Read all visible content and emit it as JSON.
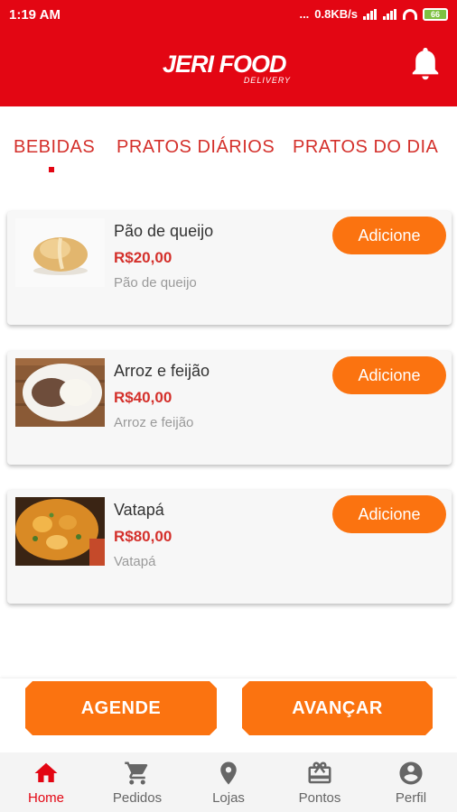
{
  "status_bar": {
    "time": "1:19 AM",
    "dots": "...",
    "network_speed": "0.8KB/s",
    "battery": "66"
  },
  "header": {
    "logo_main": "JERI FOOD",
    "logo_sub": "DELIVERY",
    "bell_icon": "bell-icon"
  },
  "tabs": [
    {
      "label": "BEBIDAS",
      "active": true
    },
    {
      "label": "PRATOS DIÁRIOS",
      "active": false
    },
    {
      "label": "PRATOS DO DIA",
      "active": false
    }
  ],
  "products": [
    {
      "name": "Pão de queijo",
      "price": "R$20,00",
      "description": "Pão de queijo",
      "button": "Adicione"
    },
    {
      "name": "Arroz e feijão",
      "price": "R$40,00",
      "description": "Arroz e feijão",
      "button": "Adicione"
    },
    {
      "name": "Vatapá",
      "price": "R$80,00",
      "description": "Vatapá",
      "button": "Adicione"
    }
  ],
  "actions": {
    "schedule": "AGENDE",
    "next": "AVANÇAR"
  },
  "nav": [
    {
      "label": "Home",
      "icon": "home-icon",
      "active": true
    },
    {
      "label": "Pedidos",
      "icon": "cart-icon",
      "active": false
    },
    {
      "label": "Lojas",
      "icon": "location-pin-icon",
      "active": false
    },
    {
      "label": "Pontos",
      "icon": "gift-icon",
      "active": false
    },
    {
      "label": "Perfil",
      "icon": "account-circle-icon",
      "active": false
    }
  ],
  "colors": {
    "brand_red": "#e30613",
    "accent_orange": "#fb7310",
    "price_red": "#d4302b"
  }
}
